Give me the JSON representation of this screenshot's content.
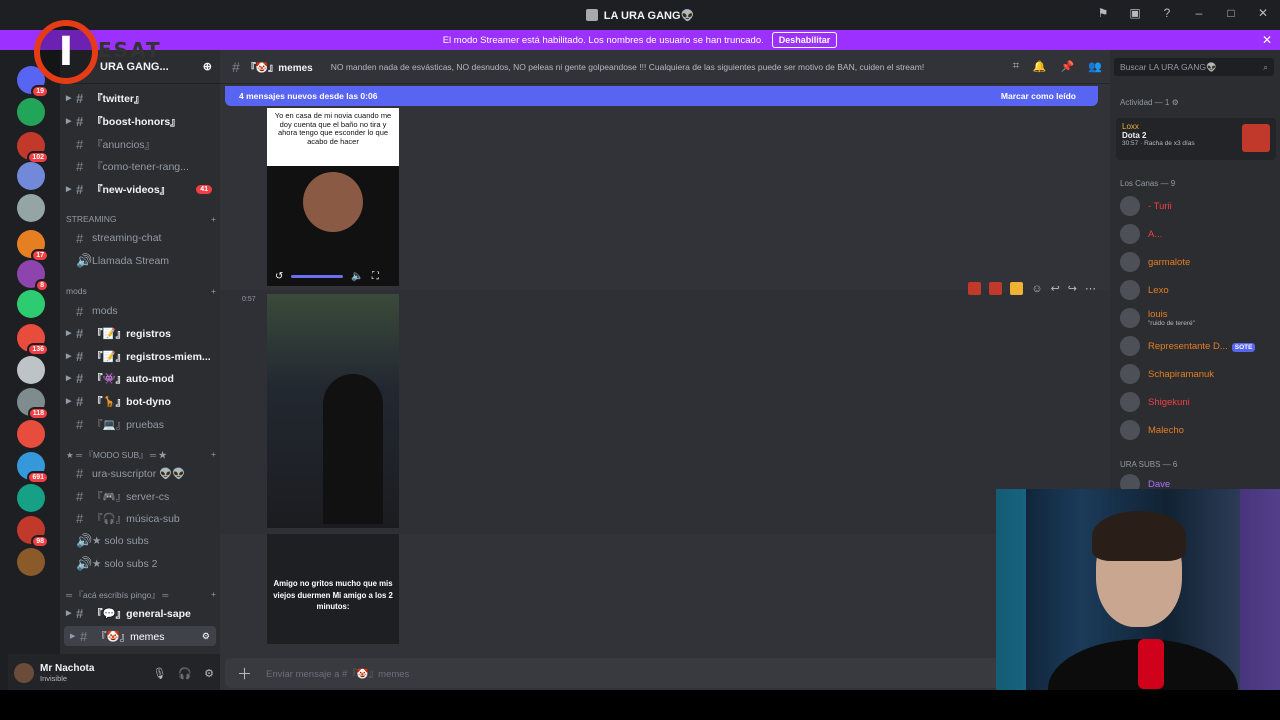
{
  "window": {
    "title": "LA URA GANG👽"
  },
  "banner": {
    "text": "El modo Streamer está habilitado. Los nombres de usuario se han truncado.",
    "button": "Deshabilitar"
  },
  "overlay_logo": {
    "letter": "I",
    "text": "ESAT"
  },
  "server": {
    "name": "URA GANG..."
  },
  "servers": [
    {
      "badge": "19"
    },
    {
      "badge": ""
    },
    {
      "badge": "102"
    },
    {
      "badge": ""
    },
    {
      "badge": ""
    },
    {
      "badge": "17"
    },
    {
      "badge": "8"
    },
    {
      "badge": ""
    },
    {
      "badge": "136"
    },
    {
      "badge": ""
    },
    {
      "badge": "118"
    },
    {
      "badge": ""
    },
    {
      "badge": "691"
    },
    {
      "badge": ""
    },
    {
      "badge": "98"
    },
    {
      "badge": ""
    }
  ],
  "channels": {
    "twitter": "『twitter』",
    "boost": "『boost-honors』",
    "anuncios": "『anuncios』",
    "como": "『como-tener-rang...",
    "newvideos": "『new-videos』",
    "newvideos_count": "41",
    "cat_streaming": "STREAMING",
    "streaming_chat": "streaming-chat",
    "llamada": "Llamada Stream",
    "cat_mods": "mods",
    "mods": "mods",
    "registros": "『📝』registros",
    "registros_m": "『📝』registros-miem...",
    "automod": "『👾』auto-mod",
    "botdyno": "『🦒』bot-dyno",
    "pruebas": "『💻』pruebas",
    "cat_modosub": "★ ═ 『MODO SUB』 ═ ★",
    "urasus": "ura-suscriptor 👽👽",
    "servercs": "『🎮』server-cs",
    "musica": "『🎧』música-sub",
    "solosubs": "★ solo subs",
    "solosubs2": "★ solo subs 2",
    "cat_aca": "═ 『acá escribís pingo』 ═",
    "general": "『💬』general-sape",
    "memes": "『🤡』memes"
  },
  "user": {
    "name": "Mr Nachota",
    "status": "Invisible"
  },
  "header": {
    "channel": "『🤡』memes",
    "topic": "NO manden nada de esvásticas, NO desnudos, NO peleas ni gente golpeandose !!! Cualquiera de las siguientes puede ser motivo de BAN, cuiden el stream!"
  },
  "newbar": {
    "text": "4 mensajes nuevos desde las 0:06",
    "action": "Marcar como leído"
  },
  "messages": {
    "img1_caption": "Yo en casa de mi novia cuando me doy cuenta que el baño no tira y ahora tengo que esconder lo que acabo de hacer",
    "timestamp": "0:57",
    "img3_caption": "Amigo no gritos mucho que mis viejos duermen Mi amigo a los 2 minutos:"
  },
  "composer": {
    "placeholder": "Enviar mensaje a #『🤡』memes"
  },
  "members": {
    "search_placeholder": "Buscar LA URA GANG👽",
    "activity_header": "Actividad — 1",
    "activity": {
      "name": "Loxx",
      "game": "Dota 2",
      "time": "30:57",
      "streak": "Racha de x3 días"
    },
    "group1": "Los Canas — 9",
    "list1": [
      {
        "name": "- Turii",
        "color": "#f23f43"
      },
      {
        "name": "A...",
        "color": "#f23f43"
      },
      {
        "name": "garmalote",
        "color": "#e67e22"
      },
      {
        "name": "Lexo",
        "color": "#e67e22"
      },
      {
        "name": "louis",
        "color": "#e67e22",
        "sub": "\"ruido de tereré\""
      },
      {
        "name": "Representante D...",
        "color": "#e67e22",
        "tag": "SOTE"
      },
      {
        "name": "Schapiramanuk",
        "color": "#e67e22"
      },
      {
        "name": "Shigekuni",
        "color": "#f23f43"
      },
      {
        "name": "Malecho",
        "color": "#e67e22"
      }
    ],
    "group2": "URA SUBS — 6",
    "list2": [
      {
        "name": "Dave",
        "color": "#a970ff"
      }
    ]
  }
}
